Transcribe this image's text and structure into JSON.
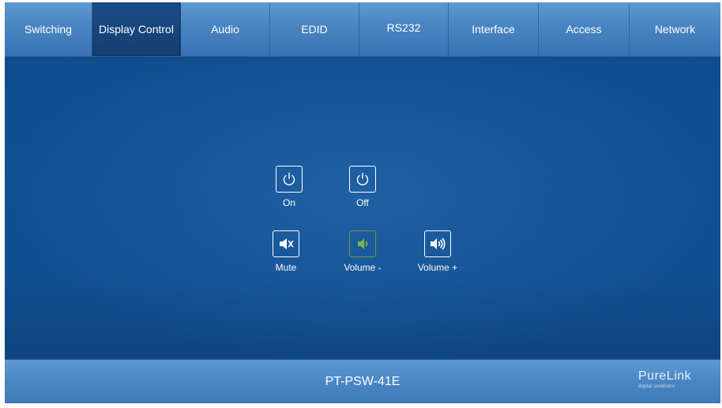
{
  "nav": {
    "tabs": [
      {
        "label": "Switching"
      },
      {
        "label": "Display Control",
        "active": true
      },
      {
        "label": "Audio"
      },
      {
        "label": "EDID"
      },
      {
        "label": "RS232"
      },
      {
        "label": "Interface"
      },
      {
        "label": "Access"
      },
      {
        "label": "Network"
      }
    ]
  },
  "controls": {
    "on": {
      "label": "On",
      "icon": "power-icon"
    },
    "off": {
      "label": "Off",
      "icon": "power-icon"
    },
    "mute": {
      "label": "Mute",
      "icon": "speaker-mute-icon"
    },
    "volume_down": {
      "label": "Volume -",
      "icon": "speaker-low-icon",
      "highlight_color": "#7ab648"
    },
    "volume_up": {
      "label": "Volume +",
      "icon": "speaker-high-icon"
    }
  },
  "footer": {
    "model": "PT-PSW-41E",
    "logo_main": "PureLink",
    "logo_sub": "digital solutions"
  },
  "colors": {
    "background": "#0f4f91",
    "nav_bar": "#4a86c4",
    "active_tab": "#143f72",
    "accent_green": "#7ab648"
  }
}
